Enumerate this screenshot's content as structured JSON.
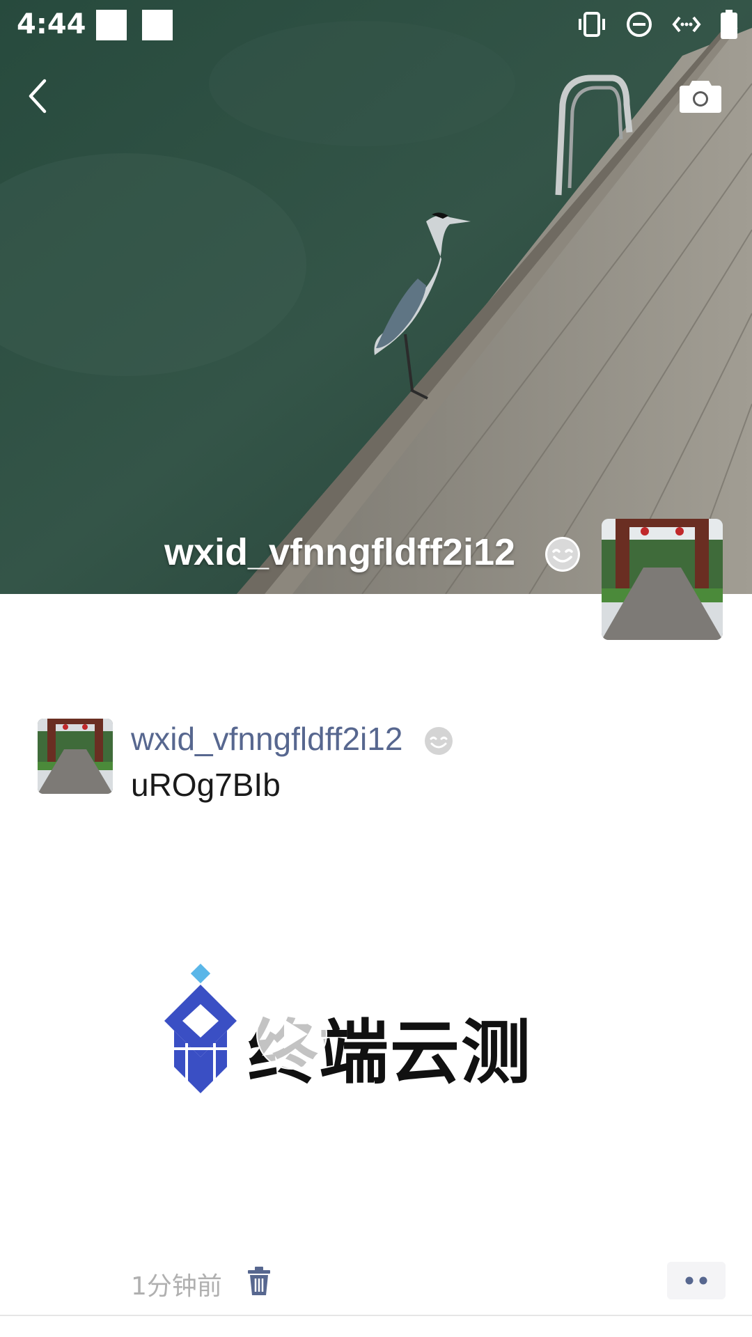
{
  "status_bar": {
    "time": "4:44",
    "icons": [
      "vibrate-icon",
      "do-not-disturb-icon",
      "data-transfer-icon",
      "battery-icon"
    ]
  },
  "header": {
    "back_icon": "chevron-left-icon",
    "camera_icon": "camera-icon"
  },
  "profile": {
    "name": "wxid_vfnngfldff2i12",
    "status_icon": "smile-icon"
  },
  "post": {
    "author": "wxid_vfnngfldff2i12",
    "text": "uROg7BIb",
    "video_caption": "终端云测",
    "time": "1分钟前",
    "delete_icon": "trash-icon",
    "more_icon": "more-dots-icon"
  },
  "colors": {
    "name_link": "#57678f",
    "time_gray": "#b0b0b0",
    "logo_blue": "#3a4fc4"
  }
}
